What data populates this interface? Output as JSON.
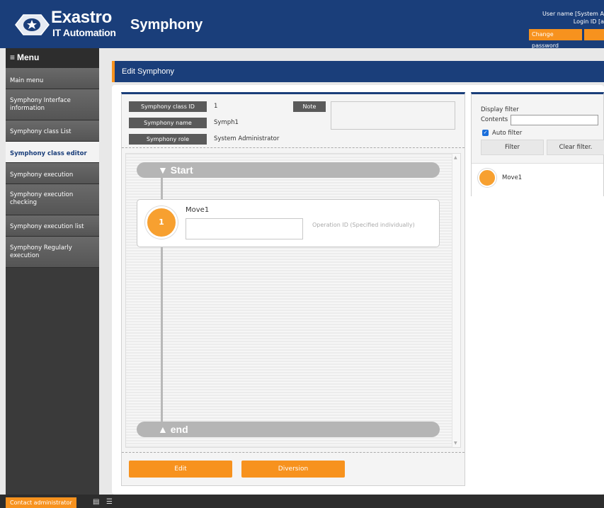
{
  "header": {
    "logo_title": "Exastro",
    "logo_subtitle": "IT Automation",
    "app_title": "Symphony",
    "user_name_line": "User name [System A",
    "login_id_line": "Login ID [a",
    "change_password_label": "Change password"
  },
  "sidebar": {
    "menu_title": "Menu",
    "items": [
      {
        "label": "Main menu",
        "active": false
      },
      {
        "label": "Symphony Interface information",
        "active": false
      },
      {
        "label": "Symphony class List",
        "active": false
      },
      {
        "label": "Symphony class editor",
        "active": true
      },
      {
        "label": "Symphony execution",
        "active": false
      },
      {
        "label": "Symphony execution checking",
        "active": false
      },
      {
        "label": "Symphony execution list",
        "active": false
      },
      {
        "label": "Symphony Regularly execution",
        "active": false
      }
    ]
  },
  "page": {
    "title": "Edit Symphony"
  },
  "info": {
    "class_id_label": "Symphony class ID",
    "class_id_value": "1",
    "name_label": "Symphony name",
    "name_value": "Symph1",
    "role_label": "Symphony role",
    "role_value": "System Administrator",
    "note_label": "Note",
    "note_value": ""
  },
  "flow": {
    "start_label": "▼ Start",
    "end_label": "▲ end",
    "nodes": [
      {
        "order": "1",
        "name": "Move1",
        "operation_value": "",
        "operation_hint": "Operation ID (Specified individually)"
      }
    ]
  },
  "buttons": {
    "edit": "Edit",
    "diversion": "Diversion"
  },
  "filter": {
    "display_filter_label": "Display filter",
    "contents_label": "Contents",
    "contents_value": "",
    "auto_filter_label": "Auto filter",
    "auto_filter_checked": true,
    "filter_button": "Filter",
    "clear_button": "Clear filter."
  },
  "movement_list": [
    {
      "name": "Move1"
    }
  ],
  "footer": {
    "contact_label": "Contact administrator"
  },
  "colors": {
    "header_blue": "#1a3e7a",
    "accent_orange": "#f7921e",
    "node_orange": "#f7a030"
  }
}
